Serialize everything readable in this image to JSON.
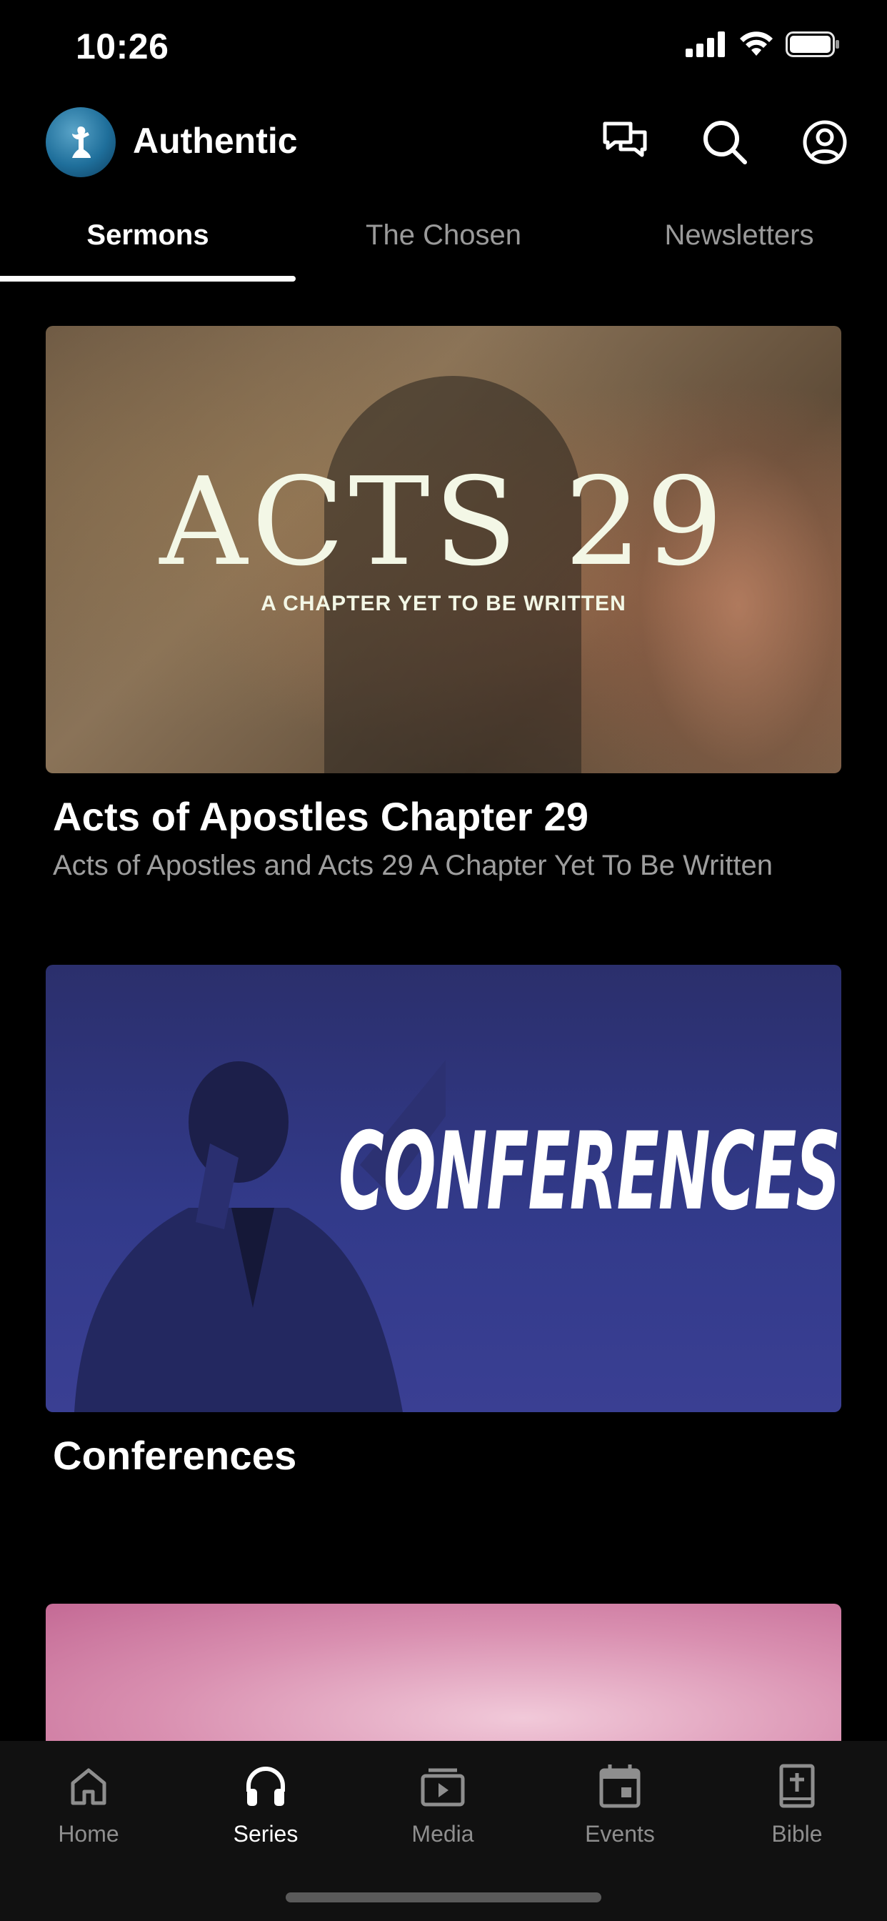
{
  "status_bar": {
    "time": "10:26"
  },
  "header": {
    "app_name": "Authentic"
  },
  "tabs": [
    {
      "label": "Sermons",
      "active": true
    },
    {
      "label": "The Chosen",
      "active": false
    },
    {
      "label": "Newsletters",
      "active": false
    }
  ],
  "cards": [
    {
      "artwork_heading": "ACTS 29",
      "artwork_tagline": "A CHAPTER YET TO BE WRITTEN",
      "title": "Acts of Apostles Chapter 29",
      "subtitle": "Acts of Apostles and Acts 29 A Chapter Yet To Be Written"
    },
    {
      "artwork_heading": "CONFERENCES",
      "title": "Conferences"
    },
    {
      "title": ""
    }
  ],
  "bottom_nav": [
    {
      "label": "Home",
      "icon": "home-icon",
      "active": false
    },
    {
      "label": "Series",
      "icon": "headphones-icon",
      "active": true
    },
    {
      "label": "Media",
      "icon": "media-icon",
      "active": false
    },
    {
      "label": "Events",
      "icon": "calendar-icon",
      "active": false
    },
    {
      "label": "Bible",
      "icon": "bible-icon",
      "active": false
    }
  ],
  "colors": {
    "background": "#000000",
    "active_text": "#ffffff",
    "inactive_text": "#9a9a9a",
    "conference_blue": "#323a8a"
  }
}
